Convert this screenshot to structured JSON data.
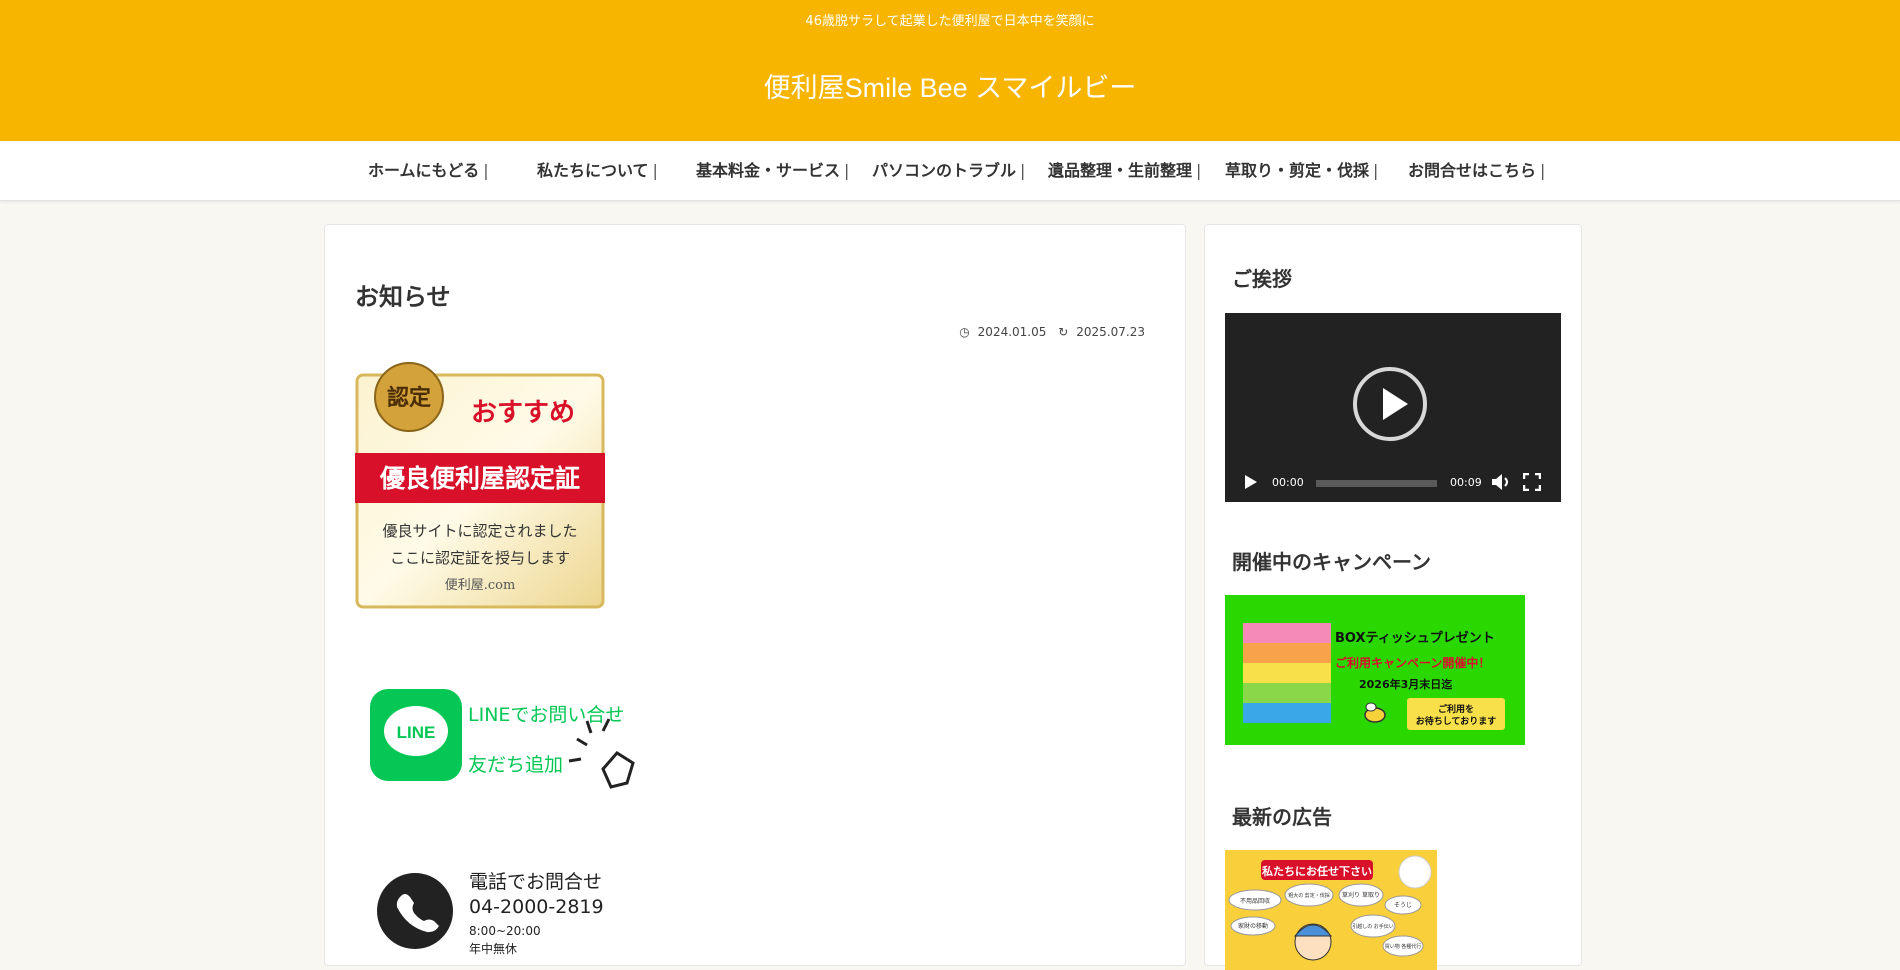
{
  "header": {
    "tagline": "46歳脱サラして起業した便利屋で日本中を笑顔に",
    "site_title": "便利屋Smile Bee スマイルビー"
  },
  "nav": {
    "items": [
      {
        "label": "ホームにもどる"
      },
      {
        "label": "私たちについて"
      },
      {
        "label": "基本料金・サービス"
      },
      {
        "label": "パソコンのトラブル"
      },
      {
        "label": "遺品整理・生前整理"
      },
      {
        "label": "草取り・剪定・伐採"
      },
      {
        "label": "お問合せはこちら"
      }
    ],
    "separator": "|"
  },
  "article": {
    "title": "お知らせ",
    "published": "2024.01.05",
    "updated": "2025.07.23",
    "certificate": {
      "badge": "認定",
      "recommend": "おすすめ",
      "ribbon": "優良便利屋認定証",
      "line1": "優良サイトに認定されました",
      "line2": "ここに認定証を授与します",
      "site": "便利屋.com"
    },
    "line_banner": {
      "logo": "LINE",
      "text1": "LINEでお問い合せ",
      "text2": "友だち追加"
    },
    "phone_banner": {
      "text1": "電話でお問合せ",
      "number": "04-2000-2819",
      "hours": "8:00~20:00",
      "holiday": "年中無休"
    }
  },
  "sidebar": {
    "greeting_title": "ご挨拶",
    "video": {
      "current": "00:00",
      "duration": "00:09",
      "progress": 0
    },
    "campaign_title": "開催中のキャンペーン",
    "campaign": {
      "line1": "BOXティッシュプレゼント",
      "line2": "ご利用キャンペーン開催中！",
      "line3": "2026年3月末日迄",
      "note1": "ご利用を",
      "note2": "お待ちしております"
    },
    "ad_title": "最新の広告",
    "ad": {
      "headline": "私たちにお任せ下さい",
      "bubble1": "不用品回収",
      "bubble2": "粗大の 剪定・伐採",
      "bubble3": "草刈り 草取り",
      "bubble4": "そうじ",
      "bubble5": "家財の移動",
      "bubble6": "引越しの お手伝い",
      "bubble7": "買い物 各種代行"
    }
  },
  "colors": {
    "brand": "#f7b500",
    "line_green": "#06c755",
    "campaign_green": "#2ad800",
    "ribbon_red": "#d8102a"
  }
}
